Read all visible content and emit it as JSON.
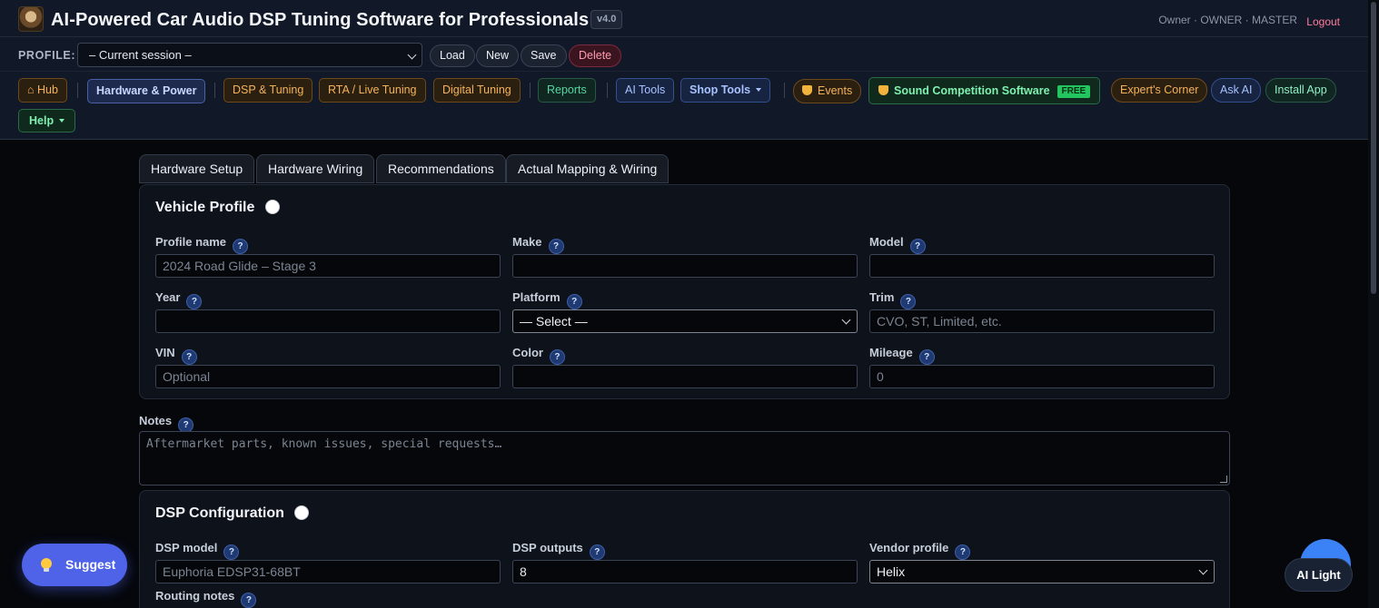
{
  "app": {
    "title": "AI-Powered Car Audio DSP Tuning Software for Professionals",
    "version": "v4.0",
    "user_info": "Owner · OWNER · MASTER",
    "logout": "Logout"
  },
  "profile_bar": {
    "label": "PROFILE:",
    "selected": "– Current session –",
    "load": "Load",
    "new": "New",
    "save": "Save",
    "delete": "Delete"
  },
  "nav": {
    "hub": "⌂ Hub",
    "hardware_power": "Hardware & Power",
    "dsp_tuning": "DSP & Tuning",
    "rta_live": "RTA / Live Tuning",
    "digital_tuning": "Digital Tuning",
    "reports": "Reports",
    "ai_tools": "AI Tools",
    "shop_tools": "Shop Tools",
    "events": "Events",
    "sound_competition": "Sound Competition Software",
    "free_badge": "FREE",
    "experts_corner": "Expert's Corner",
    "ask_ai": "Ask AI",
    "install_app": "Install App",
    "help": "Help"
  },
  "tabs": [
    "Hardware Setup",
    "Hardware Wiring",
    "Recommendations",
    "Actual Mapping & Wiring"
  ],
  "help_glyph": "?",
  "vehicle_profile": {
    "title": "Vehicle Profile",
    "profile_name_label": "Profile name",
    "profile_name_placeholder": "2024 Road Glide – Stage 3",
    "make_label": "Make",
    "model_label": "Model",
    "year_label": "Year",
    "platform_label": "Platform",
    "platform_selected": "— Select —",
    "trim_label": "Trim",
    "trim_placeholder": "CVO, ST, Limited, etc.",
    "vin_label": "VIN",
    "vin_placeholder": "Optional",
    "color_label": "Color",
    "mileage_label": "Mileage",
    "mileage_placeholder": "0"
  },
  "notes": {
    "label": "Notes",
    "placeholder": "Aftermarket parts, known issues, special requests…"
  },
  "dsp_config": {
    "title": "DSP Configuration",
    "model_label": "DSP model",
    "model_placeholder": "Euphoria EDSP31-68BT",
    "outputs_label": "DSP outputs",
    "outputs_value": "8",
    "vendor_label": "Vendor profile",
    "vendor_selected": "Helix",
    "routing_label": "Routing notes"
  },
  "floating": {
    "suggest": "Suggest",
    "ai_light": "AI Light"
  }
}
